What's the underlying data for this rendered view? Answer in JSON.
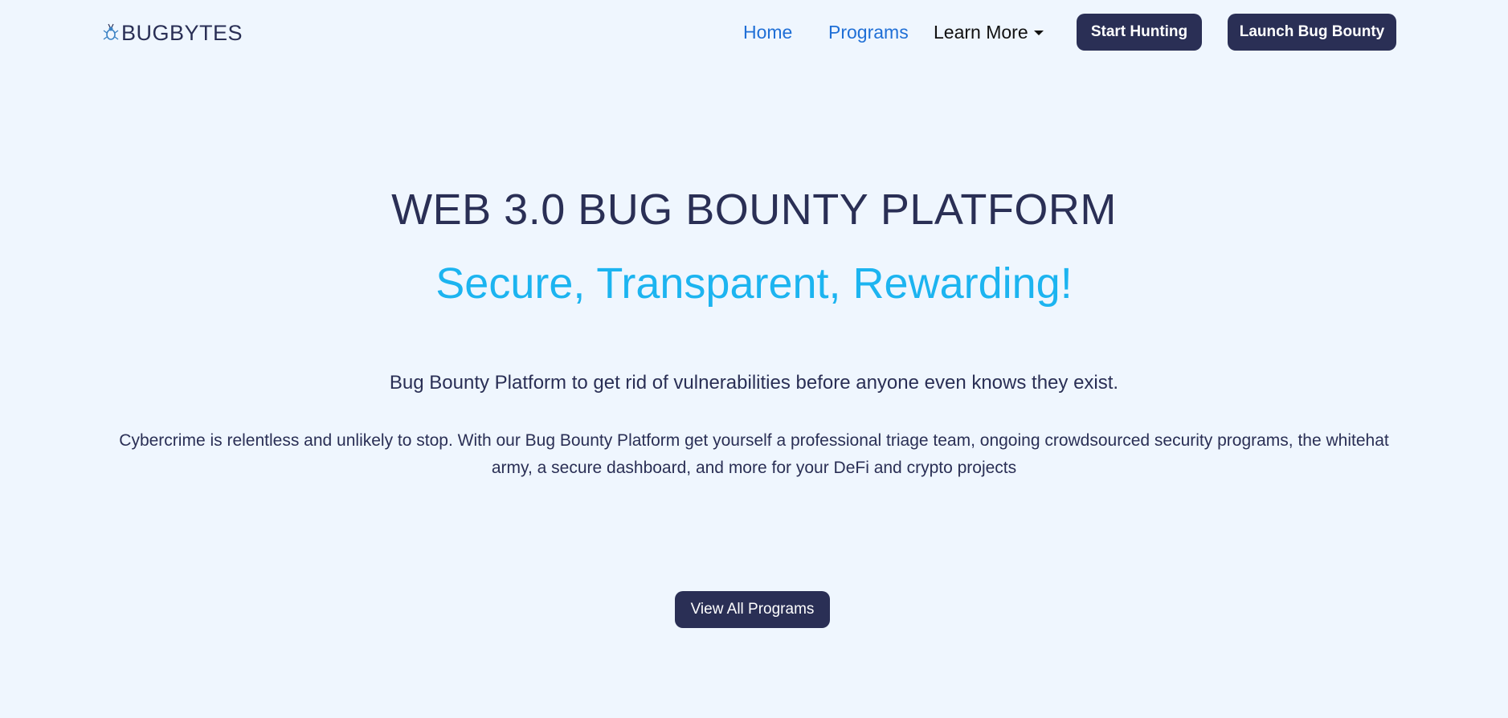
{
  "nav": {
    "logo_text": "BUGBYTES",
    "links": [
      {
        "label": "Home"
      },
      {
        "label": "Programs"
      },
      {
        "label": "Learn More"
      }
    ],
    "start_hunting_label": "Start Hunting",
    "launch_label": "Launch Bug Bounty"
  },
  "hero": {
    "title": "WEB 3.0 BUG BOUNTY PLATFORM",
    "subtitle": "Secure, Transparent, Rewarding!",
    "lead": "Bug Bounty Platform to get rid of vulnerabilities before anyone even knows they exist.",
    "description": "Cybercrime is relentless and unlikely to stop. With our Bug Bounty Platform get yourself a professional triage team, ongoing crowdsourced security programs, the whitehat army, a secure dashboard, and more for your DeFi and crypto projects",
    "cta_label": "View All Programs"
  },
  "colors": {
    "background": "#eff6fe",
    "primary": "#2a2f55",
    "accent": "#1cb4f0",
    "link": "#1f6fd6"
  },
  "icons": {
    "logo": "bug-icon",
    "dropdown": "caret-down-icon"
  }
}
